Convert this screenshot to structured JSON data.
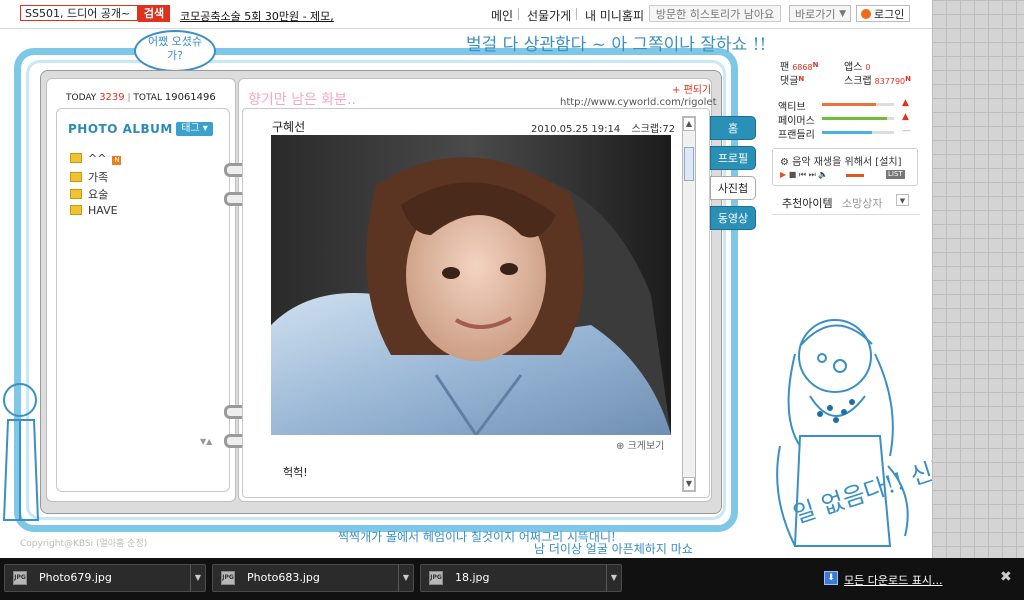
{
  "topbar": {
    "search_value": "SS501, 드디어 공개~",
    "search_button": "검색",
    "promo": "코모공축소술 5회 30만원 - 제모,",
    "nav": [
      "메인",
      "선물가게",
      "내 미니홈피"
    ],
    "history": "방문한 히스토리가 남아요",
    "shortcut": "바로가기",
    "login": "로그인"
  },
  "decor": {
    "top_slogan": "벌걸 다 상관함다 ~ 아 그쪽이나 잘하쇼 !!",
    "bubble": "어쨌 오셨슈가?",
    "bottom_slogan": "찍찍개가 몰에서 헤엄이나 칠것이지 어쩌그리 시뜩대니!",
    "bottom_slogan2": "남 더이상 얼굴 아픈체하지 마쇼",
    "right_slogan": "일 없음다!! 신경끄쇼-",
    "copyright": "Copyright@KBSi (얼아홈 순정)"
  },
  "visits": {
    "today_label": "TODAY",
    "today_value": "3239",
    "total_label": "TOTAL",
    "total_value": "19061496"
  },
  "album": {
    "title": "PHOTO ALBUM",
    "tag_button": "태그",
    "folders": [
      {
        "name": "^^",
        "new": "N"
      },
      {
        "name": "가족"
      },
      {
        "name": "요술"
      },
      {
        "name": "HAVE"
      }
    ]
  },
  "minihompy": {
    "title": "향기만 남은 화분..",
    "edit_link": "편되기",
    "url": "http://www.cyworld.com/rigolet"
  },
  "post": {
    "author": "구혜선",
    "datetime": "2010.05.25 19:14",
    "scrap": "스크랩:72",
    "zoom": "크게보기",
    "caption": "헉헉!"
  },
  "tabs": [
    "홈",
    "프로필",
    "사진첩",
    "동영상"
  ],
  "active_tab": "사진첩",
  "stats": {
    "fan_label": "팬",
    "fan_value": "6868",
    "apps_label": "앱스",
    "apps_value": "0",
    "comment_label": "댓글",
    "scrap_label": "스크랩",
    "scrap_value": "837790",
    "new_mark": "N"
  },
  "meters": [
    {
      "label": "액티브",
      "level": 0.75,
      "color": "#e8743b",
      "arrow": "▲"
    },
    {
      "label": "페이머스",
      "level": 0.9,
      "color": "#6bbf3a",
      "arrow": "▲"
    },
    {
      "label": "프랜들리",
      "level": 0.7,
      "color": "#49b2dd",
      "arrow": "—"
    }
  ],
  "player": {
    "text": "음악 재생을 위해서 [설치]",
    "list": "LIST"
  },
  "recommend": {
    "items": "추천아이템",
    "wishbox": "소망상자"
  },
  "downloads": [
    "Photo679.jpg",
    "Photo683.jpg",
    "18.jpg"
  ],
  "download_icon_text": "JPG",
  "show_all": "모든 다운로드 표시..."
}
